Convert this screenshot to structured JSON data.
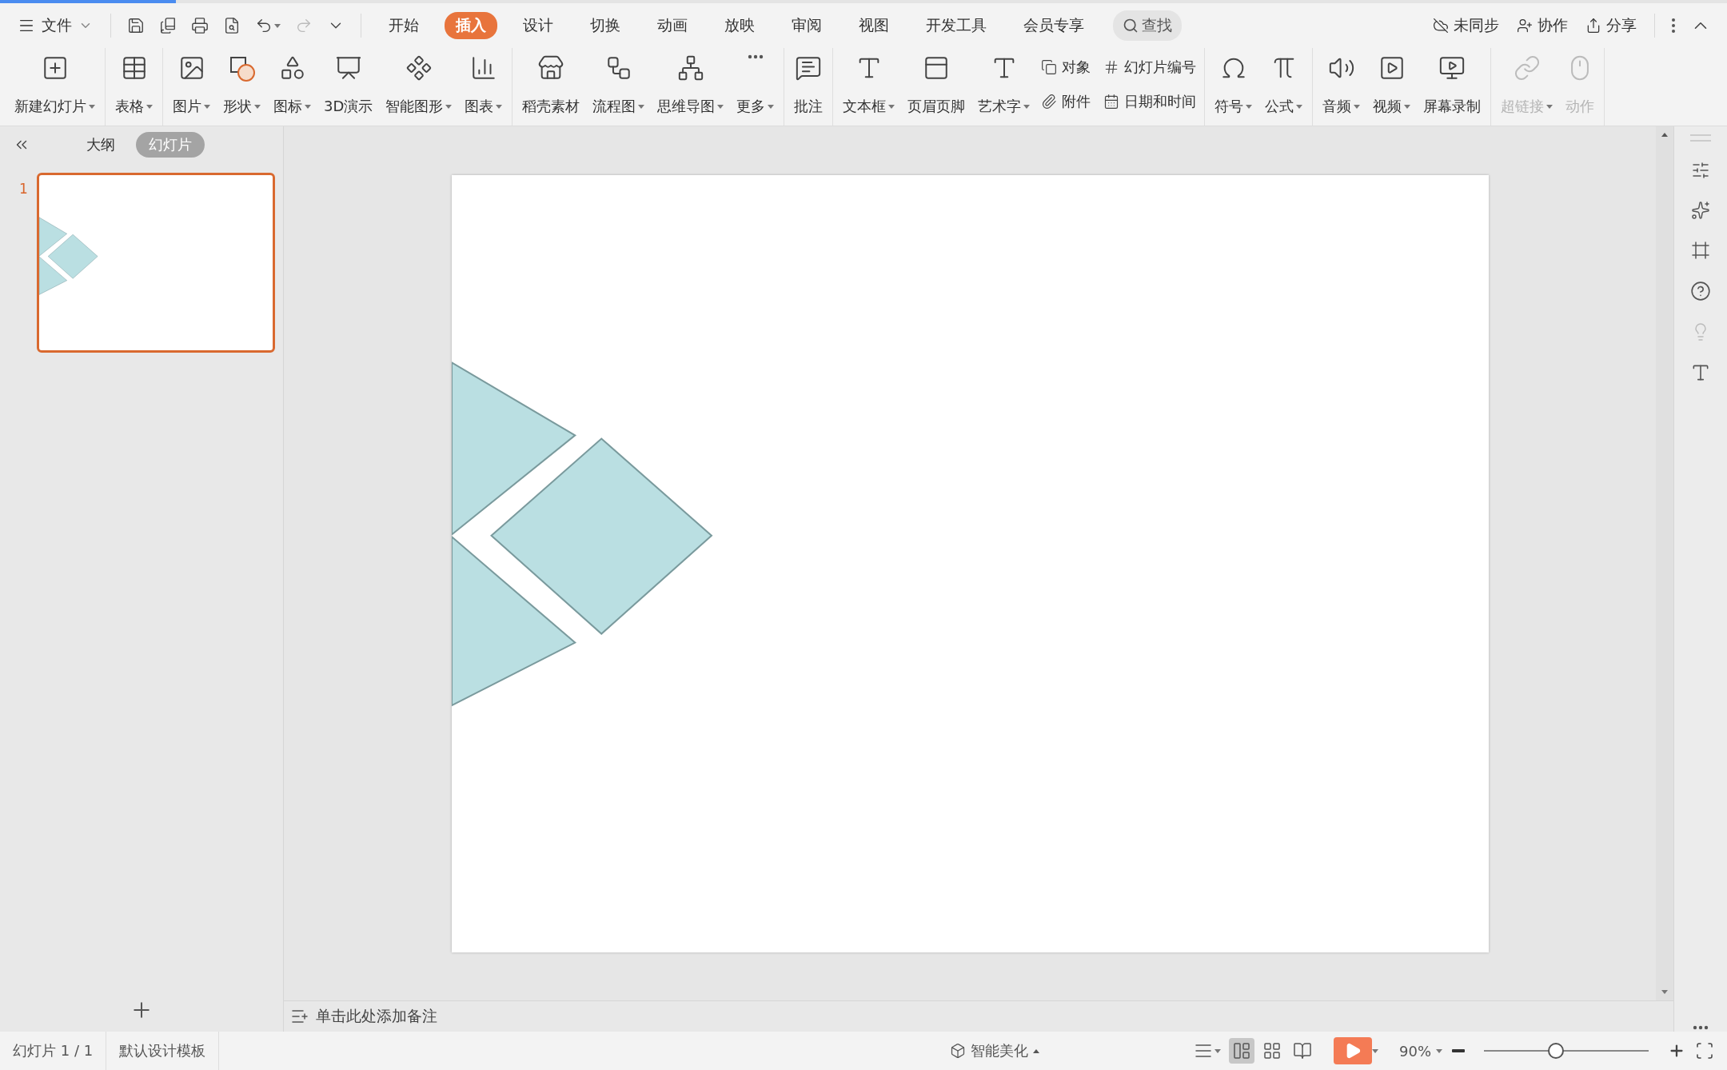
{
  "menu_bar": {
    "file_menu": {
      "label": "文件"
    },
    "quick_access": [
      {
        "disabled": false,
        "dropdown": false
      },
      {
        "disabled": false,
        "dropdown": false
      },
      {
        "disabled": false,
        "dropdown": false
      },
      {
        "disabled": false,
        "dropdown": false
      },
      {
        "disabled": false,
        "dropdown": true
      },
      {
        "disabled": true,
        "dropdown": false
      },
      {
        "disabled": false,
        "dropdown": false
      }
    ],
    "tabs": [
      {
        "label": "开始",
        "selected": false
      },
      {
        "label": "插入",
        "selected": true
      },
      {
        "label": "设计",
        "selected": false
      },
      {
        "label": "切换",
        "selected": false
      },
      {
        "label": "动画",
        "selected": false
      },
      {
        "label": "放映",
        "selected": false
      },
      {
        "label": "审阅",
        "selected": false
      },
      {
        "label": "视图",
        "selected": false
      },
      {
        "label": "开发工具",
        "selected": false
      },
      {
        "label": "会员专享",
        "selected": false
      }
    ],
    "search": {
      "label": "查找"
    },
    "account_actions": [
      {
        "label": "未同步"
      },
      {
        "label": "协作"
      },
      {
        "label": "分享"
      }
    ]
  },
  "ribbon": {
    "groups": [
      {
        "items": [
          {
            "kind": "large",
            "label": "新建幻灯片",
            "dropdown": true,
            "disabled": false
          }
        ]
      },
      {
        "items": [
          {
            "kind": "large",
            "label": "表格",
            "dropdown": true,
            "disabled": false
          }
        ]
      },
      {
        "items": [
          {
            "kind": "large",
            "label": "图片",
            "dropdown": true,
            "disabled": false
          },
          {
            "kind": "large",
            "label": "形状",
            "dropdown": true,
            "disabled": false
          },
          {
            "kind": "large",
            "label": "图标",
            "dropdown": true,
            "disabled": false
          },
          {
            "kind": "large",
            "label": "3D演示",
            "dropdown": false,
            "disabled": false
          },
          {
            "kind": "large",
            "label": "智能图形",
            "dropdown": true,
            "disabled": false
          },
          {
            "kind": "large",
            "label": "图表",
            "dropdown": true,
            "disabled": false
          }
        ]
      },
      {
        "items": [
          {
            "kind": "large",
            "label": "稻壳素材",
            "dropdown": false,
            "disabled": false
          },
          {
            "kind": "large",
            "label": "流程图",
            "dropdown": true,
            "disabled": false
          },
          {
            "kind": "large",
            "label": "思维导图",
            "dropdown": true,
            "disabled": false
          },
          {
            "kind": "large",
            "label": "更多",
            "dropdown": true,
            "disabled": false
          }
        ]
      },
      {
        "items": [
          {
            "kind": "large",
            "label": "批注",
            "dropdown": false,
            "disabled": false
          }
        ]
      },
      {
        "items": [
          {
            "kind": "large",
            "label": "文本框",
            "dropdown": true,
            "disabled": false
          },
          {
            "kind": "large",
            "label": "页眉页脚",
            "dropdown": false,
            "disabled": false
          },
          {
            "kind": "large",
            "label": "艺术字",
            "dropdown": true,
            "disabled": false
          },
          {
            "kind": "small",
            "label": "对象",
            "dropdown": false,
            "disabled": false
          },
          {
            "kind": "small",
            "label": "附件",
            "dropdown": false,
            "disabled": false
          },
          {
            "kind": "small",
            "label": "幻灯片编号",
            "dropdown": false,
            "disabled": false
          },
          {
            "kind": "small",
            "label": "日期和时间",
            "dropdown": false,
            "disabled": false
          }
        ]
      },
      {
        "items": [
          {
            "kind": "large",
            "label": "符号",
            "dropdown": true,
            "disabled": false
          },
          {
            "kind": "large",
            "label": "公式",
            "dropdown": true,
            "disabled": false
          }
        ]
      },
      {
        "items": [
          {
            "kind": "large",
            "label": "音频",
            "dropdown": true,
            "disabled": false
          },
          {
            "kind": "large",
            "label": "视频",
            "dropdown": true,
            "disabled": false
          },
          {
            "kind": "large",
            "label": "屏幕录制",
            "dropdown": false,
            "disabled": false
          }
        ]
      },
      {
        "items": [
          {
            "kind": "large",
            "label": "超链接",
            "dropdown": true,
            "disabled": true
          },
          {
            "kind": "large",
            "label": "动作",
            "dropdown": false,
            "disabled": true
          }
        ]
      }
    ]
  },
  "left_panel": {
    "tabs": [
      {
        "label": "大纲",
        "selected": false
      },
      {
        "label": "幻灯片",
        "selected": true
      }
    ],
    "slides": [
      {
        "number": "1",
        "selected": true
      }
    ]
  },
  "notes_prompt": "单击此处添加备注",
  "status_bar": {
    "slide_counter": "幻灯片 1 / 1",
    "template": "默认设计模板",
    "beautify": "智能美化",
    "views": [
      {
        "selected": false
      },
      {
        "selected": true
      },
      {
        "selected": false
      },
      {
        "selected": false
      }
    ],
    "zoom": {
      "label": "90%",
      "level": 0.43
    }
  }
}
